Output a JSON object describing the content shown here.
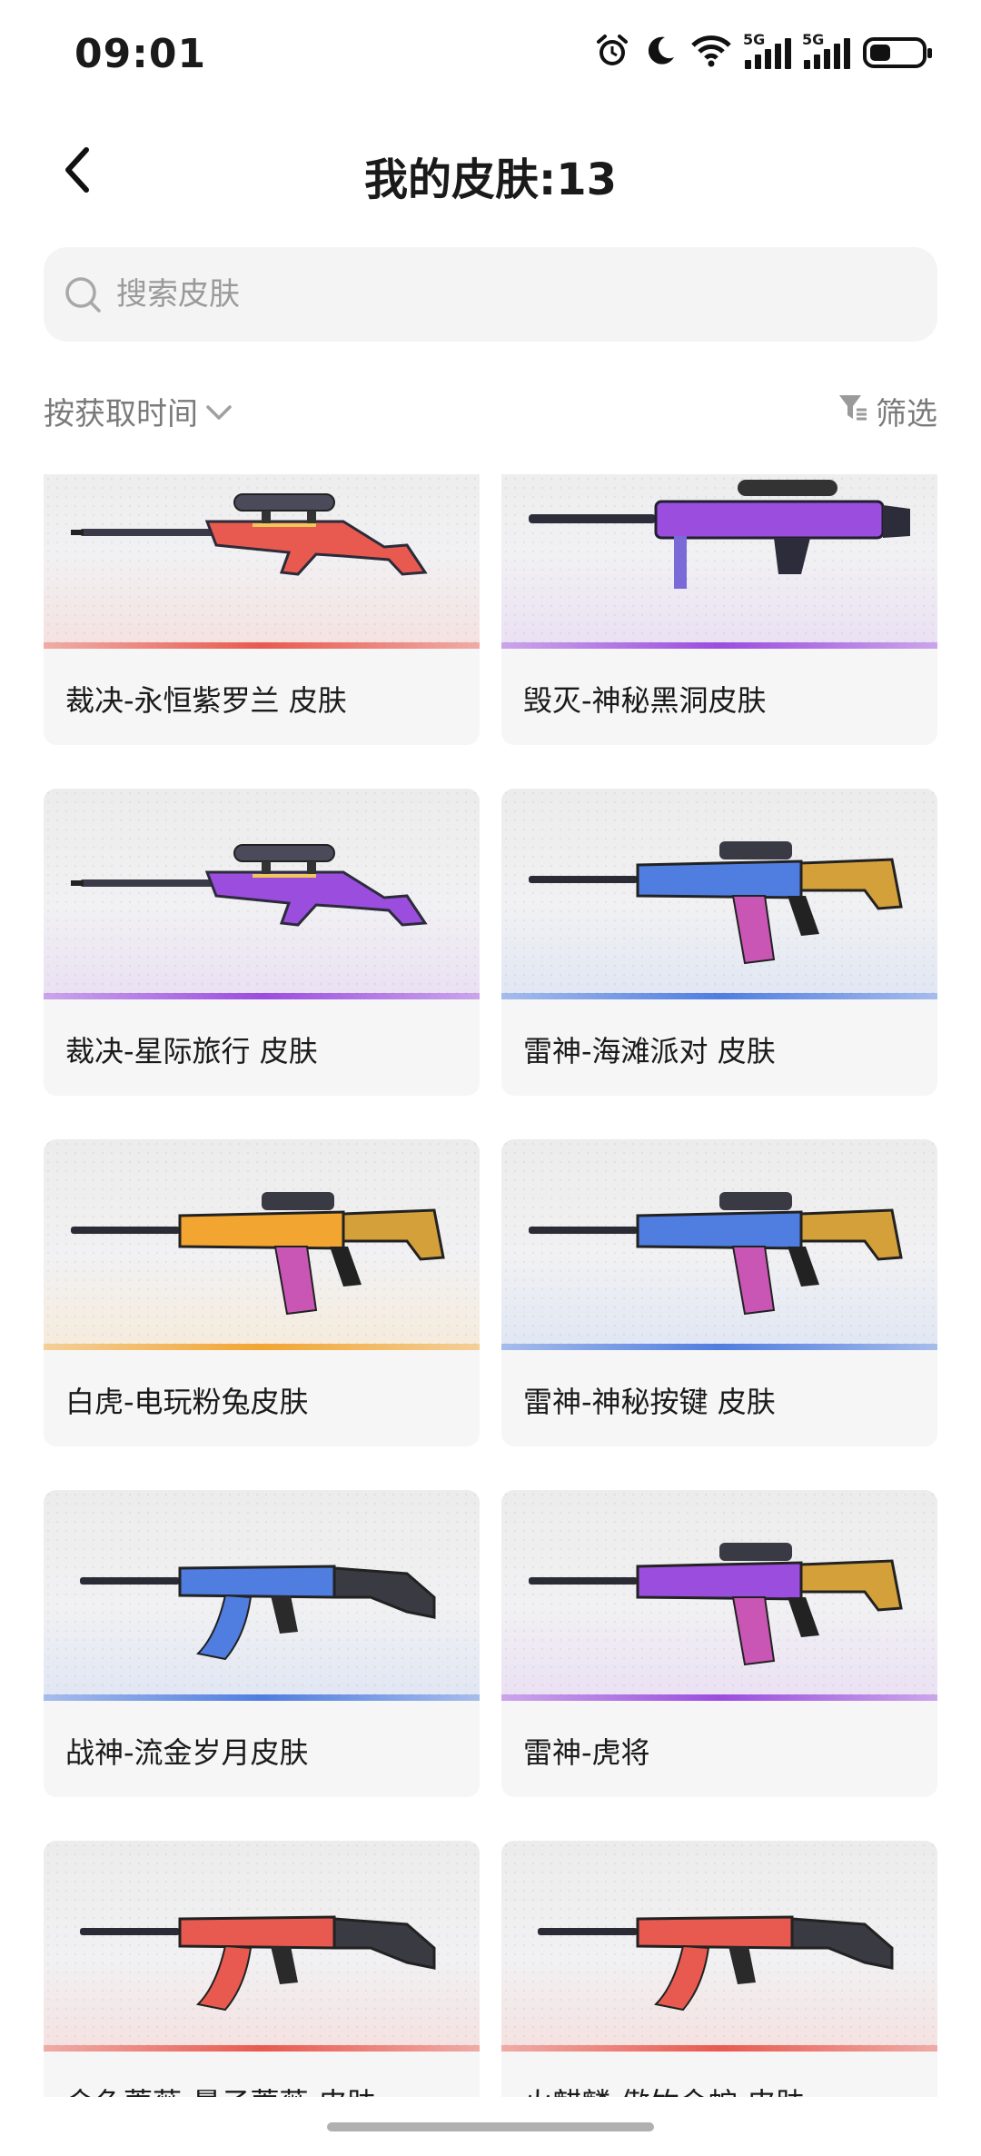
{
  "status_bar": {
    "time": "09:01",
    "icons": [
      "alarm-icon",
      "moon-icon",
      "wifi-icon",
      "signal-5g-icon",
      "signal-5g-icon",
      "battery-icon"
    ],
    "network_label_1": "5G",
    "network_label_2": "5G"
  },
  "header": {
    "title": "我的皮肤:13",
    "back_icon": "chevron-left-icon"
  },
  "search": {
    "placeholder": "搜索皮肤",
    "value": ""
  },
  "toolbar": {
    "sort_label": "按获取时间",
    "filter_label": "筛选"
  },
  "skins": [
    {
      "name": "裁决-永恒紫罗兰 皮肤",
      "rarity_color": "#e85a4f",
      "weapon": "sniper"
    },
    {
      "name": "毁灭-神秘黑洞皮肤",
      "rarity_color": "#9b4dde",
      "weapon": "heavy"
    },
    {
      "name": "裁决-星际旅行 皮肤",
      "rarity_color": "#9b4dde",
      "weapon": "sniper"
    },
    {
      "name": "雷神-海滩派对 皮肤",
      "rarity_color": "#4f7de0",
      "weapon": "rifle"
    },
    {
      "name": "白虎-电玩粉兔皮肤",
      "rarity_color": "#f2a531",
      "weapon": "rifle"
    },
    {
      "name": "雷神-神秘按键 皮肤",
      "rarity_color": "#4f7de0",
      "weapon": "rifle"
    },
    {
      "name": "战神-流金岁月皮肤",
      "rarity_color": "#4f7de0",
      "weapon": "ak"
    },
    {
      "name": "雷神-虎将",
      "rarity_color": "#9b4dde",
      "weapon": "rifle"
    },
    {
      "name": "金色蔷薇-量子蔷薇 皮肤",
      "rarity_color": "#e85a4f",
      "weapon": "ak"
    },
    {
      "name": "火麒麟-傲竹金蛇 皮肤",
      "rarity_color": "#e85a4f",
      "weapon": "ak"
    }
  ],
  "colors": {
    "text_primary": "#1a1a1a",
    "text_secondary": "#7a7a7a",
    "search_bg": "#f4f4f4",
    "card_bg": "#f6f6f6"
  }
}
